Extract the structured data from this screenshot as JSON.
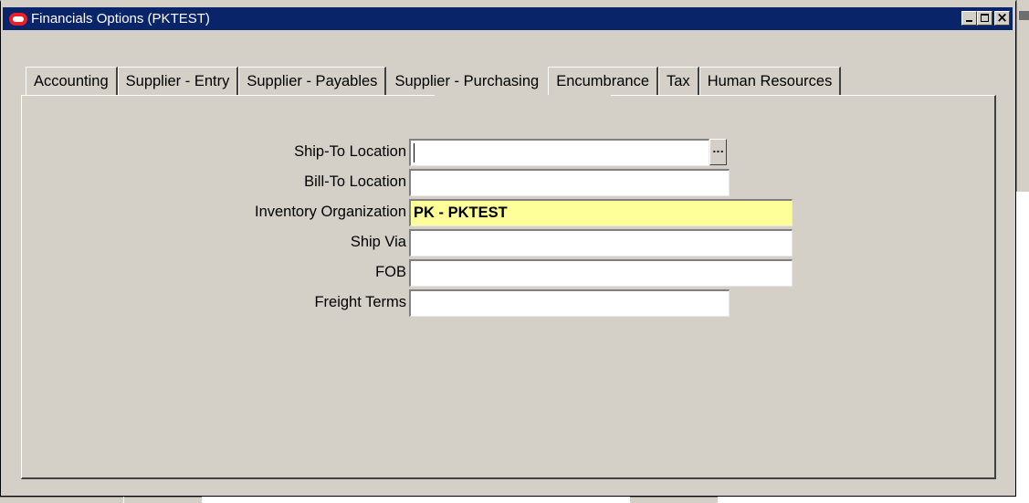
{
  "window": {
    "title": "Financials Options (PKTEST)",
    "icon": "oracle-icon",
    "controls": {
      "minimize": "minimize-icon",
      "maximize": "maximize-icon",
      "close": "close-icon",
      "close_glyph": "×"
    }
  },
  "tabs": [
    {
      "label": "Accounting",
      "active": false
    },
    {
      "label": "Supplier - Entry",
      "active": false
    },
    {
      "label": "Supplier - Payables",
      "active": false
    },
    {
      "label": "Supplier - Purchasing",
      "active": true
    },
    {
      "label": "Encumbrance",
      "active": false
    },
    {
      "label": "Tax",
      "active": false
    },
    {
      "label": "Human Resources",
      "active": false
    }
  ],
  "form": {
    "ship_to_location": {
      "label": "Ship-To Location",
      "value": "",
      "lov_label": "..."
    },
    "bill_to_location": {
      "label": "Bill-To Location",
      "value": ""
    },
    "inventory_organization": {
      "label": "Inventory Organization",
      "value": "PK - PKTEST"
    },
    "ship_via": {
      "label": "Ship Via",
      "value": ""
    },
    "fob": {
      "label": "FOB",
      "value": ""
    },
    "freight_terms": {
      "label": "Freight Terms",
      "value": ""
    }
  },
  "colors": {
    "titlebar": "#0a246a",
    "window_bg": "#d4d0c8",
    "required_field": "#ffff99"
  }
}
